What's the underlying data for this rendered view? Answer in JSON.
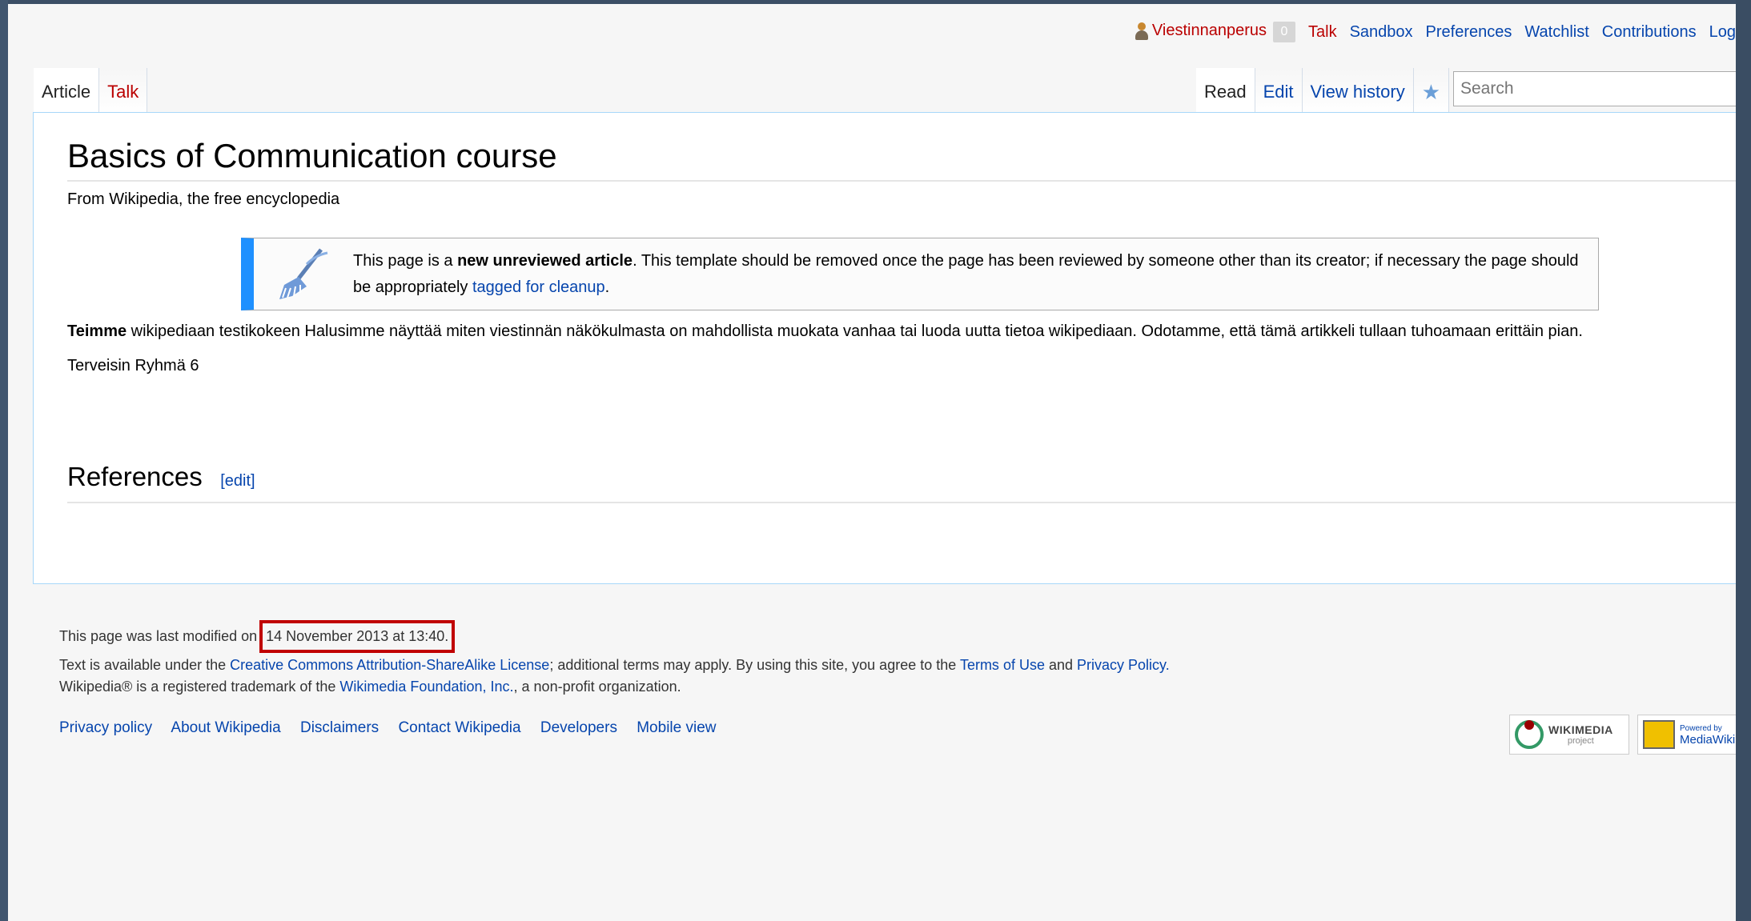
{
  "personal_tools": {
    "username": "Viestinnanperus",
    "notifications": "0",
    "items": [
      "Talk",
      "Sandbox",
      "Preferences",
      "Watchlist",
      "Contributions",
      "Log"
    ]
  },
  "tabs": {
    "left": [
      "Article",
      "Talk"
    ],
    "right": [
      "Read",
      "Edit",
      "View history"
    ],
    "watch_icon": "star-icon"
  },
  "search": {
    "placeholder": "Search"
  },
  "page": {
    "title": "Basics of Communication course",
    "site_sub": "From Wikipedia, the free encyclopedia",
    "notice": {
      "icon": "broom-icon",
      "text_before": "This page is a ",
      "bold": "new unreviewed article",
      "text_middle": ". This template should be removed once the page has been reviewed by someone other than its creator; if necessary the page should be appropriately ",
      "link": "tagged for cleanup",
      "text_after": "."
    },
    "paragraph1_bold": "Teimme",
    "paragraph1_rest": " wikipediaan testikokeen Halusimme näyttää miten viestinnän näkökulmasta on mahdollista muokata vanhaa tai luoda uutta tietoa wikipediaan. Odotamme, että tämä artikkeli tullaan tuhoamaan erittäin pian.",
    "paragraph2": "Terveisin Ryhmä 6",
    "references_heading": "References",
    "references_edit": "[edit]"
  },
  "footer": {
    "last_modified_prefix": "This page was last modified on ",
    "last_modified_date": "14 November 2013 at 13:40.",
    "license_1": "Text is available under the ",
    "license_link": "Creative Commons Attribution-ShareAlike License",
    "license_2": "; additional terms may apply. By using this site, you agree to the ",
    "terms_link": "Terms of Use",
    "and_text": " and ",
    "privacy_link": "Privacy Policy.",
    "trademark_1": "Wikipedia® is a registered trademark of the ",
    "foundation_link": "Wikimedia Foundation, Inc.",
    "trademark_2": ", a non-profit organization.",
    "links": [
      "Privacy policy",
      "About Wikipedia",
      "Disclaimers",
      "Contact Wikipedia",
      "Developers",
      "Mobile view"
    ],
    "badge_wikimedia": "WIKIMEDIA",
    "badge_wikimedia_sub": "project",
    "badge_mediawiki_top": "Powered by",
    "badge_mediawiki": "MediaWiki"
  },
  "colors": {
    "link": "#0645ad",
    "redlink": "#ba0000",
    "highlight_box": "#c00000",
    "notice_bar": "#1e90ff"
  }
}
